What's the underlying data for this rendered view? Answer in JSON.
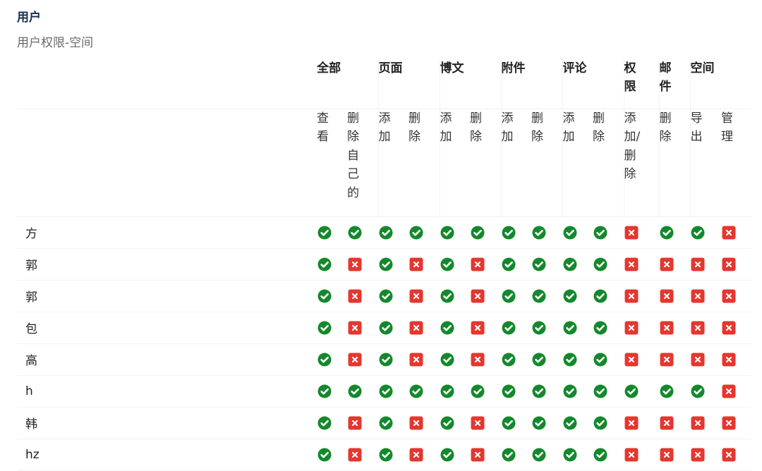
{
  "page": {
    "title": "用户",
    "subtitle": "用户权限-空间"
  },
  "groups": [
    {
      "label": "全部",
      "cols": 2
    },
    {
      "label": "页面",
      "cols": 2
    },
    {
      "label": "博文",
      "cols": 2
    },
    {
      "label": "附件",
      "cols": 2
    },
    {
      "label": "评论",
      "cols": 2
    },
    {
      "label": "权限",
      "cols": 1
    },
    {
      "label": "邮件",
      "cols": 1
    },
    {
      "label": "空间",
      "cols": 2
    }
  ],
  "columns": [
    "查看",
    "删除自己的",
    "添加",
    "删除",
    "添加",
    "删除",
    "添加",
    "删除",
    "添加",
    "删除",
    "添加/删除",
    "删除",
    "导出",
    "管理"
  ],
  "icon_colors": {
    "granted": "#14892c",
    "denied": "#e5372f"
  },
  "icons": {
    "granted": "check-circle-icon",
    "denied": "x-square-icon"
  },
  "users": [
    {
      "name": "方",
      "perms": [
        1,
        1,
        1,
        1,
        1,
        1,
        1,
        1,
        1,
        1,
        0,
        1,
        1,
        0
      ]
    },
    {
      "name": "郭",
      "perms": [
        1,
        0,
        1,
        0,
        1,
        0,
        1,
        1,
        1,
        1,
        0,
        0,
        0,
        0
      ]
    },
    {
      "name": "郭",
      "perms": [
        1,
        0,
        1,
        0,
        1,
        0,
        1,
        1,
        1,
        1,
        0,
        0,
        0,
        0
      ]
    },
    {
      "name": "包",
      "perms": [
        1,
        0,
        1,
        0,
        1,
        0,
        1,
        1,
        1,
        1,
        0,
        0,
        0,
        0
      ]
    },
    {
      "name": "高",
      "perms": [
        1,
        0,
        1,
        0,
        1,
        0,
        1,
        1,
        1,
        1,
        0,
        0,
        0,
        0
      ]
    },
    {
      "name": "h",
      "perms": [
        1,
        1,
        1,
        1,
        1,
        1,
        1,
        1,
        1,
        1,
        1,
        1,
        1,
        0
      ]
    },
    {
      "name": "韩",
      "perms": [
        1,
        0,
        1,
        0,
        1,
        0,
        1,
        1,
        1,
        1,
        0,
        0,
        0,
        0
      ]
    },
    {
      "name": "hz",
      "perms": [
        1,
        0,
        1,
        0,
        1,
        0,
        1,
        1,
        1,
        1,
        0,
        0,
        0,
        0
      ]
    }
  ]
}
